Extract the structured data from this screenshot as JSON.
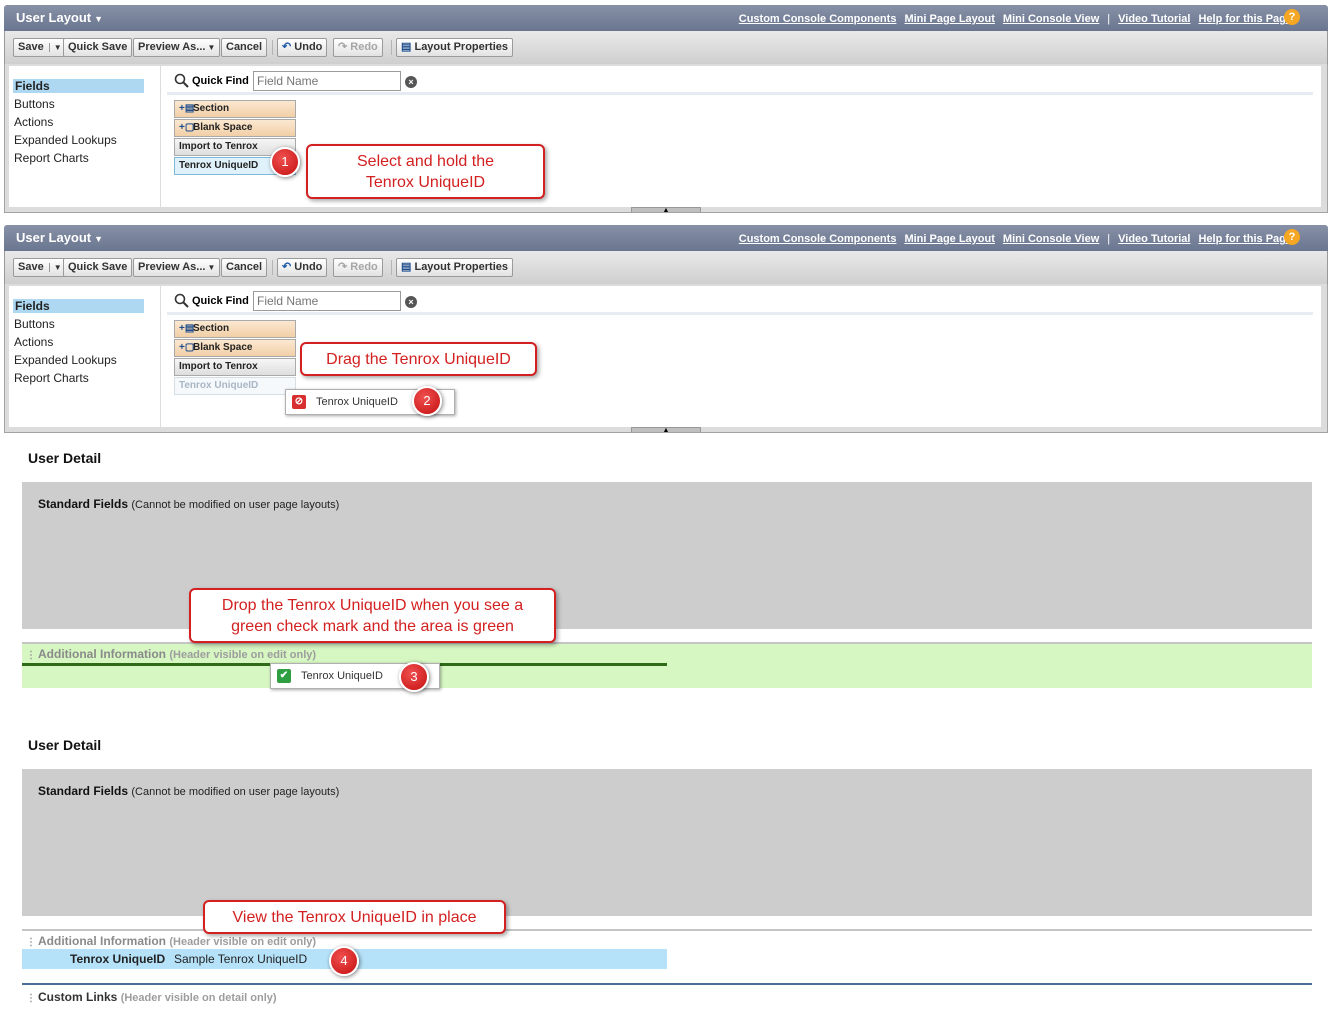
{
  "editor": {
    "title": "User Layout",
    "header_links": [
      "Custom Console Components",
      "Mini Page Layout",
      "Mini Console View",
      "Video Tutorial",
      "Help for this Page"
    ],
    "toolbar": {
      "save": "Save",
      "quick_save": "Quick Save",
      "preview_as": "Preview As...",
      "cancel": "Cancel",
      "undo": "Undo",
      "redo": "Redo",
      "layout_properties": "Layout Properties"
    },
    "nav": [
      "Fields",
      "Buttons",
      "Actions",
      "Expanded Lookups",
      "Report Charts"
    ],
    "quick_find": {
      "label": "Quick Find",
      "placeholder": "Field Name"
    },
    "palette": [
      "Section",
      "Blank Space",
      "Import to Tenrox",
      "Tenrox UniqueID"
    ]
  },
  "callouts": {
    "step1": "Select and hold the Tenrox UniqueID",
    "step2": "Drag the Tenrox UniqueID",
    "step3": "Drop the Tenrox UniqueID when you see a green check mark and the area is green",
    "step4": "View the Tenrox UniqueID in place"
  },
  "badges": [
    "1",
    "2",
    "3",
    "4"
  ],
  "drag_item": "Tenrox UniqueID",
  "layout": {
    "section_title": "User Detail",
    "standard_fields": "Standard Fields",
    "standard_note": "(Cannot be modified on user page layouts)",
    "additional_info": "Additional Information",
    "additional_note": "(Header visible on edit only)",
    "field_label": "Tenrox UniqueID",
    "field_value": "Sample Tenrox UniqueID",
    "custom_links": "Custom Links",
    "custom_note": "(Header visible on detail only)"
  },
  "colors": {
    "header": "#6a7590",
    "callout": "#d32020",
    "drop_zone": "#d6f6c2",
    "selected_field": "#b6e2f9"
  }
}
